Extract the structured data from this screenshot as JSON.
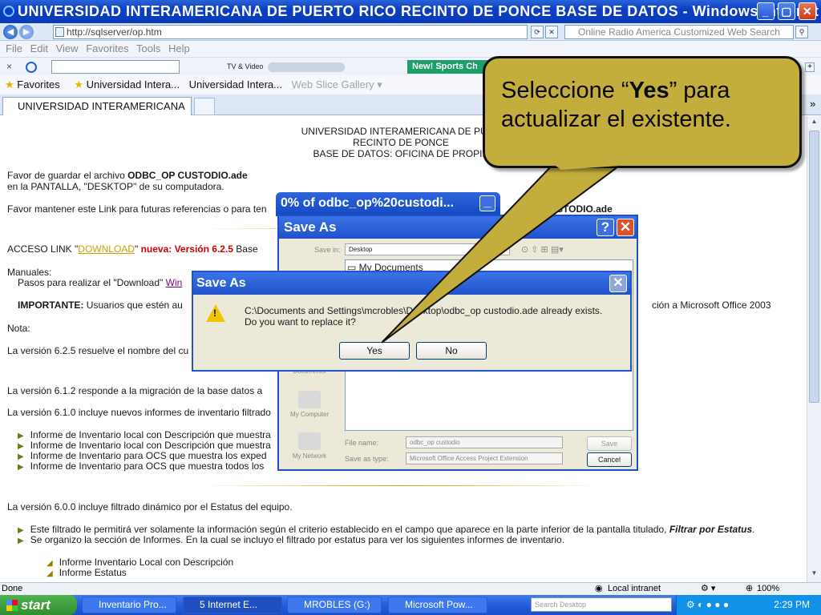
{
  "window": {
    "title": "UNIVERSIDAD INTERAMERICANA DE PUERTO RICO RECINTO DE PONCE BASE DE DATOS - Windows Internet ...",
    "address": "http://sqlserver/op.htm",
    "search_placeholder": "Online Radio America Customized Web Search"
  },
  "menu": [
    "File",
    "Edit",
    "View",
    "Favorites",
    "Tools",
    "Help"
  ],
  "toolbar": {
    "tv_label": "TV & Video",
    "news_label": "New! Sports Ch"
  },
  "favorites": {
    "label": "Favorites",
    "items": [
      "Universidad Intera...",
      "Universidad Intera...",
      "Web Slice Gallery ▾"
    ]
  },
  "tabs": [
    "UNIVERSIDAD INTERAMERICANA ..."
  ],
  "page": {
    "header1": "UNIVERSIDAD INTERAMERICANA DE PUER",
    "header2": "RECINTO DE PONCE",
    "header3": "BASE DE DATOS: OFICINA DE PROPIE",
    "save_line1_pre": "Favor de guardar el archivo ",
    "save_line1_bold": "ODBC_OP CUSTODIO.ade",
    "save_line2": "en la PANTALLA,  \"DESKTOP\" de su computadora.",
    "keep_link": "Favor mantener este Link para futuras referencias o para ten",
    "keep_link_end": "STODIO.ade",
    "access_pre": "ACCESO LINK \"",
    "access_link": "DOWNLOAD",
    "access_post": "\"",
    "access_version": " nueva: Versión 6.2.5",
    "access_tail": " Base",
    "manuales": "Manuales:",
    "pasos": "Pasos para realizar el \"Download\" ",
    "pasos_link": "Win",
    "importante_label": "IMPORTANTE:",
    "importante_text": " Usuarios que estén au",
    "importante_tail": "ción a Microsoft Office 2003",
    "nota": "Nota:",
    "v625": "La versión 6.2.5 resuelve el nombre del cu",
    "v612": "La versión 6.1.2  responde a la migración de la base datos a",
    "v610": "La versión 6.1.0 incluye nuevos informes de inventario filtrado",
    "bullets610": [
      "Informe de Inventario local con Descripción que muestra",
      "Informe de Inventario local con Descripción que muestra",
      "Informe de Inventario para OCS que muestra los exped",
      "Informe de Inventario para OCS que muestra todos los"
    ],
    "v600": "La versión 6.0.0 incluye filtrado dinámico por el Estatus del equipo.",
    "bullet600a_pre": "Este filtrado le permitirá ver solamente la información según el criterio establecido en el campo que aparece en la parte inferior de la pantalla titulado, ",
    "bullet600a_bold": "Filtrar por Estatus",
    "bullet600a_end": ".",
    "bullet600b": "Se organizo la sección de Informes. En la cual se incluyo el filtrado por estatus para ver los siguientes informes de inventario.",
    "sub1": "Informe Inventario Local con Descripción",
    "sub2": "Informe Estatus"
  },
  "download_window": {
    "title": "0% of odbc_op%20custodi..."
  },
  "save_as": {
    "title": "Save As",
    "save_in_label": "Save in:",
    "save_in_value": "Desktop",
    "list_item": "My Documents",
    "places": [
      "My Documents",
      "My Computer",
      "My Network"
    ],
    "file_name_label": "File name:",
    "file_name_value": "odbc_op custodio",
    "save_type_label": "Save as type:",
    "save_type_value": "Microsoft Office Access Project Extension",
    "save_btn": "Save",
    "cancel_btn": "Cancel"
  },
  "confirm": {
    "title": "Save As",
    "line1": "C:\\Documents and Settings\\mcrobles\\Desktop\\odbc_op custodio.ade already exists.",
    "line2": "Do you want to replace it?",
    "yes": "Yes",
    "no": "No"
  },
  "callout": {
    "pre": "Seleccione “",
    "bold": "Yes",
    "post": "” para actualizar el existente."
  },
  "status": {
    "left": "Done",
    "zone": "Local intranet",
    "zoom": "100%"
  },
  "taskbar": {
    "start": "start",
    "tasks": [
      "Inventario Pro...",
      "5 Internet E...",
      "MROBLES (G:)",
      "Microsoft Pow..."
    ],
    "search_placeholder": "Search Desktop",
    "clock": "2:29 PM"
  },
  "colors": {
    "accent": "#0b3fc4",
    "callout": "#c3ad3c",
    "link": "#c9a000"
  }
}
